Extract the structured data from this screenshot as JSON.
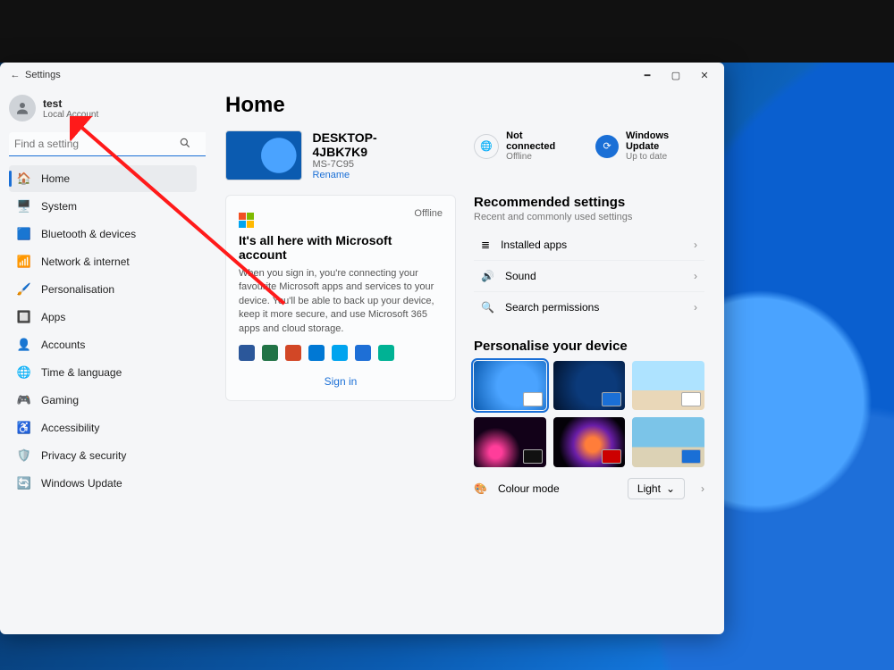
{
  "window": {
    "title": "Settings"
  },
  "user": {
    "name": "test",
    "sub": "Local Account"
  },
  "search": {
    "placeholder": "Find a setting"
  },
  "nav": [
    {
      "key": "home",
      "label": "Home",
      "icon": "🏠",
      "color": "#1a6fd6",
      "active": true
    },
    {
      "key": "system",
      "label": "System",
      "icon": "🖥️",
      "color": "#5b6068"
    },
    {
      "key": "bt",
      "label": "Bluetooth & devices",
      "icon": "🟦",
      "color": "#1a6fd6"
    },
    {
      "key": "net",
      "label": "Network & internet",
      "icon": "📶",
      "color": "#1a6fd6"
    },
    {
      "key": "pers",
      "label": "Personalisation",
      "icon": "🖌️",
      "color": "#5b6068"
    },
    {
      "key": "apps",
      "label": "Apps",
      "icon": "🔲",
      "color": "#1a6fd6"
    },
    {
      "key": "acct",
      "label": "Accounts",
      "icon": "👤",
      "color": "#2e8b57"
    },
    {
      "key": "time",
      "label": "Time & language",
      "icon": "🌐",
      "color": "#1a6fd6"
    },
    {
      "key": "game",
      "label": "Gaming",
      "icon": "🎮",
      "color": "#777"
    },
    {
      "key": "acc",
      "label": "Accessibility",
      "icon": "♿",
      "color": "#1a6fd6"
    },
    {
      "key": "priv",
      "label": "Privacy & security",
      "icon": "🛡️",
      "color": "#5b6068"
    },
    {
      "key": "upd",
      "label": "Windows Update",
      "icon": "🔄",
      "color": "#1a6fd6"
    }
  ],
  "page": {
    "title": "Home"
  },
  "pc": {
    "name": "DESKTOP-4JBK7K9",
    "model": "MS-7C95",
    "rename": "Rename"
  },
  "net_status": {
    "title": "Not connected",
    "sub": "Offline"
  },
  "update_status": {
    "title": "Windows Update",
    "sub": "Up to date"
  },
  "ms_card": {
    "status": "Offline",
    "heading": "It's all here with Microsoft account",
    "body": "When you sign in, you're connecting your favourite Microsoft apps and services to your device. You'll be able to back up your device, keep it more secure, and use Microsoft 365 apps and cloud storage.",
    "signin": "Sign in",
    "tiles": [
      "#2b579a",
      "#217346",
      "#d24726",
      "#0078d4",
      "#00a4ef",
      "#1e6fd6",
      "#00b294"
    ]
  },
  "recommended": {
    "title": "Recommended settings",
    "sub": "Recent and commonly used settings",
    "items": [
      {
        "icon": "≣",
        "label": "Installed apps"
      },
      {
        "icon": "🔊",
        "label": "Sound"
      },
      {
        "icon": "🔍",
        "label": "Search permissions"
      }
    ]
  },
  "personalise": {
    "title": "Personalise your device",
    "colour_label": "Colour mode",
    "colour_value": "Light"
  }
}
